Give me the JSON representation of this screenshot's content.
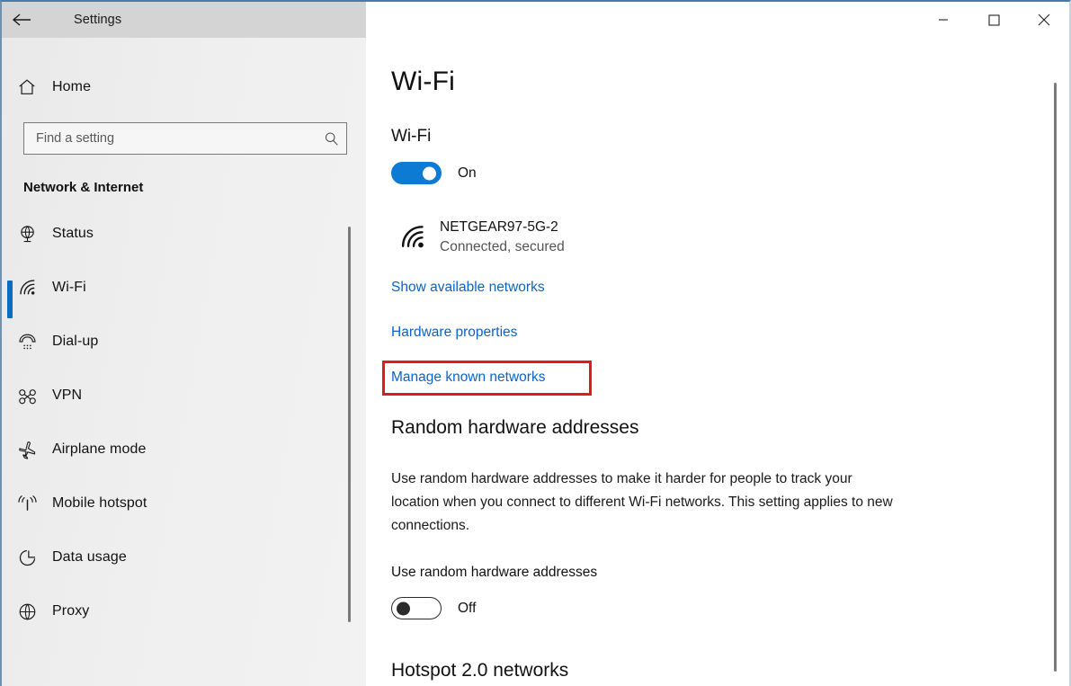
{
  "window": {
    "title": "Settings",
    "back_icon": "back-arrow-icon",
    "controls": {
      "minimize": "minimize-icon",
      "maximize": "maximize-icon",
      "close": "close-icon"
    }
  },
  "sidebar": {
    "home": {
      "label": "Home",
      "icon": "home-icon"
    },
    "search": {
      "placeholder": "Find a setting",
      "value": "",
      "icon": "search-icon"
    },
    "group_title": "Network & Internet",
    "items": [
      {
        "label": "Status",
        "icon": "globe-icon",
        "selected": false
      },
      {
        "label": "Wi-Fi",
        "icon": "wifi-icon",
        "selected": true
      },
      {
        "label": "Dial-up",
        "icon": "phone-handset-icon",
        "selected": false
      },
      {
        "label": "VPN",
        "icon": "vpn-key-icon",
        "selected": false
      },
      {
        "label": "Airplane mode",
        "icon": "airplane-icon",
        "selected": false
      },
      {
        "label": "Mobile hotspot",
        "icon": "hotspot-icon",
        "selected": false
      },
      {
        "label": "Data usage",
        "icon": "pie-chart-icon",
        "selected": false
      },
      {
        "label": "Proxy",
        "icon": "globe-grid-icon",
        "selected": false
      }
    ]
  },
  "content": {
    "page_title": "Wi-Fi",
    "wifi_section_label": "Wi-Fi",
    "wifi_toggle": {
      "state": "On",
      "on": true
    },
    "network": {
      "name": "NETGEAR97-5G-2",
      "status": "Connected, secured",
      "icon": "wifi-signal-icon"
    },
    "links": [
      {
        "label": "Show available networks",
        "highlighted": false
      },
      {
        "label": "Hardware properties",
        "highlighted": false
      },
      {
        "label": "Manage known networks",
        "highlighted": true
      }
    ],
    "random_hardware": {
      "title": "Random hardware addresses",
      "description": "Use random hardware addresses to make it harder for people to track your location when you connect to different Wi-Fi networks. This setting applies to new connections.",
      "toggle_label": "Use random hardware addresses",
      "toggle": {
        "state": "Off",
        "on": false
      }
    },
    "hotspot_title": "Hotspot 2.0 networks"
  },
  "colors": {
    "accent_blue": "#0d7bd4",
    "link_blue": "#0a63c9",
    "selection_blue": "#0a6cc4",
    "highlight_red": "#e11b1b",
    "sidebar_bg": "#efefef",
    "titlebar_bg": "#d4d4d4"
  }
}
